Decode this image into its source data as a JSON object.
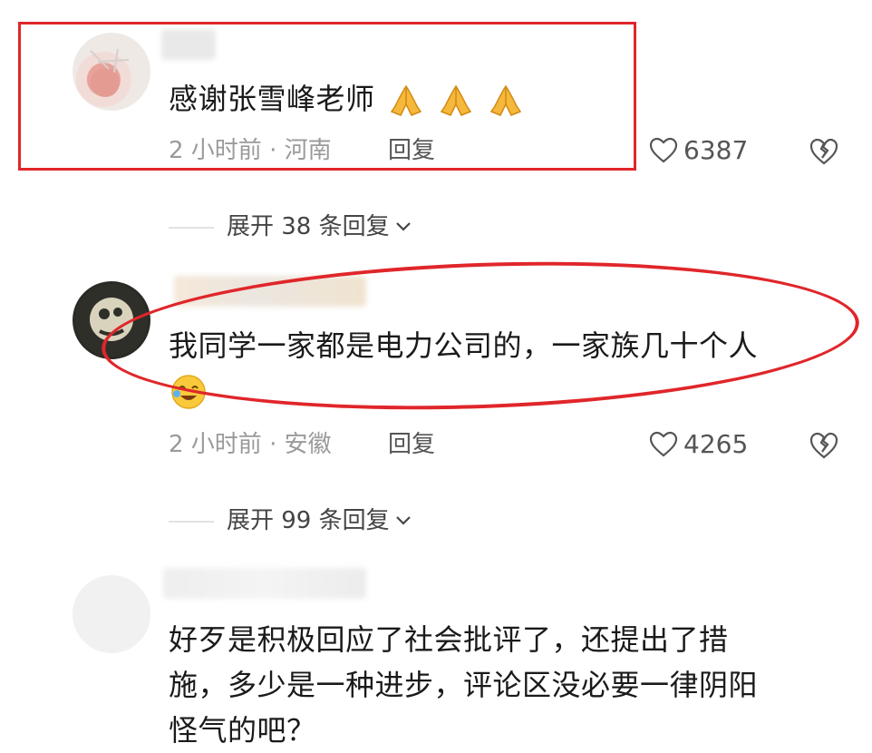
{
  "comments": [
    {
      "text": "感谢张雪峰老师",
      "emoji_names": [
        "pray-emoji",
        "pray-emoji",
        "pray-emoji"
      ],
      "time_location": "2 小时前 · 河南",
      "reply_label": "回复",
      "likes": "6387",
      "expand_label": "展开 38 条回复"
    },
    {
      "text": "我同学一家都是电力公司的，一家族几十个人",
      "emoji_name": "laughing-emoji",
      "time_location": "2 小时前 · 安徽",
      "reply_label": "回复",
      "likes": "4265",
      "expand_label": "展开 99 条回复"
    },
    {
      "text_line1": "好歹是积极回应了社会批评了，还提出了措",
      "text_line2": "施，多少是一种进步，评论区没必要一律阴阳",
      "text_line3": "怪气的吧？"
    }
  ],
  "colors": {
    "highlight": "#e0262a",
    "meta_text": "#9a9a9a",
    "body_text": "#1a1a1a"
  }
}
